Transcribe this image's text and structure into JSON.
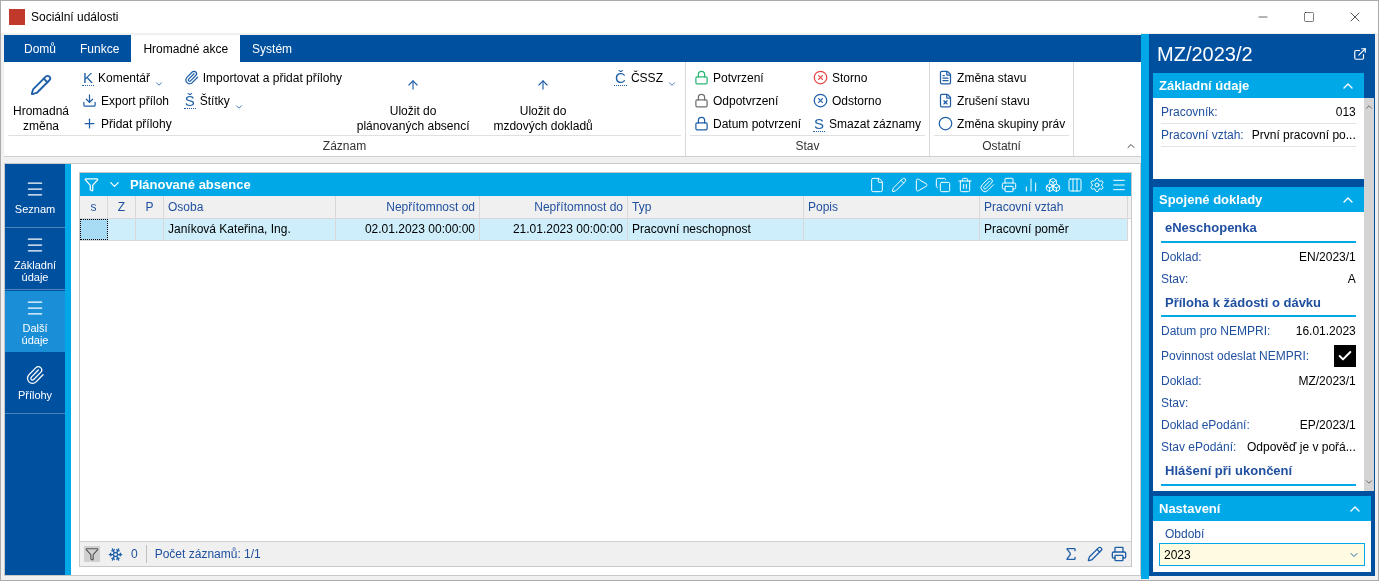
{
  "window": {
    "title": "Sociální události"
  },
  "ribbon": {
    "tabs": [
      {
        "label": "Domů",
        "selected": false
      },
      {
        "label": "Funkce",
        "selected": false
      },
      {
        "label": "Hromadné akce",
        "selected": true
      },
      {
        "label": "Systém",
        "selected": false
      }
    ],
    "groups": [
      {
        "label": "Záznam",
        "columns": [
          {
            "kind": "large",
            "items": [
              {
                "label": "Hromadná změna"
              }
            ]
          },
          {
            "kind": "small",
            "items": [
              {
                "label": "Komentář",
                "glyph": "K",
                "dropdown": true
              },
              {
                "label": "Export příloh"
              },
              {
                "label": "Přidat přílohy"
              }
            ]
          },
          {
            "kind": "small",
            "items": [
              {
                "label": "Importovat a přidat přílohy"
              },
              {
                "label": "Štítky",
                "glyph": "Š",
                "dropdown": true
              }
            ]
          },
          {
            "kind": "large",
            "items": [
              {
                "label": "Uložit do plánovaných absencí"
              }
            ]
          },
          {
            "kind": "large",
            "items": [
              {
                "label": "Uložit do mzdových dokladů"
              }
            ]
          },
          {
            "kind": "small",
            "items": [
              {
                "label": "ČSSZ",
                "glyph": "Č",
                "dropdown": true
              }
            ]
          }
        ]
      },
      {
        "label": "Stav",
        "columns": [
          {
            "kind": "small",
            "items": [
              {
                "label": "Potvrzení"
              },
              {
                "label": "Odpotvrzení"
              },
              {
                "label": "Datum potvrzení"
              }
            ]
          },
          {
            "kind": "small",
            "items": [
              {
                "label": "Storno"
              },
              {
                "label": "Odstorno"
              },
              {
                "label": "Smazat záznamy",
                "glyph": "S"
              }
            ]
          }
        ]
      },
      {
        "label": "Ostatní",
        "columns": [
          {
            "kind": "small",
            "items": [
              {
                "label": "Změna stavu"
              },
              {
                "label": "Zrušení stavu"
              },
              {
                "label": "Změna skupiny práv"
              }
            ]
          }
        ]
      }
    ]
  },
  "nav": [
    {
      "label": "Seznam",
      "selected": false
    },
    {
      "label": "Základní údaje",
      "selected": false
    },
    {
      "label": "Další údaje",
      "selected": true
    },
    {
      "label": "Přílohy",
      "selected": false
    }
  ],
  "grid": {
    "title": "Plánované absence",
    "columns": [
      {
        "label": "s"
      },
      {
        "label": "Z"
      },
      {
        "label": "P"
      },
      {
        "label": "Osoba"
      },
      {
        "label": "Nepřítomnost od"
      },
      {
        "label": "Nepřítomnost do"
      },
      {
        "label": "Typ"
      },
      {
        "label": "Popis"
      },
      {
        "label": "Pracovní vztah"
      }
    ],
    "rows": [
      {
        "selected": true,
        "cells": [
          "",
          "",
          "",
          "Janíková Kateřina, Ing.",
          "02.01.2023 00:00:00",
          "21.01.2023 00:00:00",
          "Pracovní neschopnost",
          "",
          "Pracovní poměr"
        ]
      }
    ],
    "footer": {
      "filter_count": "0",
      "record_count": "Počet záznamů: 1/1"
    }
  },
  "detail": {
    "title": "MZ/2023/2",
    "sections": [
      {
        "title": "Základní údaje",
        "expanded": true,
        "blocks": [
          {
            "fields": [
              {
                "kind": "text",
                "label": "Pracovník:",
                "value": "013"
              },
              {
                "kind": "text",
                "label": "Pracovní vztah:",
                "value": "První pracovní po..."
              }
            ]
          }
        ]
      },
      {
        "title": "Spojené doklady",
        "expanded": true,
        "blocks": [
          {
            "heading": "eNeschopenka",
            "fields": [
              {
                "kind": "text",
                "label": "Doklad:",
                "value": "EN/2023/1"
              },
              {
                "kind": "text",
                "label": "Stav:",
                "value": "A"
              }
            ]
          },
          {
            "heading": "Příloha k žádosti o dávku",
            "fields": [
              {
                "kind": "text",
                "label": "Datum pro NEMPRI:",
                "value": "16.01.2023"
              },
              {
                "kind": "checkbox",
                "label": "Povinnost odeslat NEMPRI:",
                "checked": true
              },
              {
                "kind": "text",
                "label": "Doklad:",
                "value": "MZ/2023/1"
              },
              {
                "kind": "text",
                "label": "Stav:"
              },
              {
                "kind": "text",
                "label": "Doklad ePodání:",
                "value": "EP/2023/1"
              },
              {
                "kind": "text",
                "label": "Stav ePodání:",
                "value": "Odpověď je v pořá..."
              }
            ]
          },
          {
            "heading": "Hlášení při ukončení"
          }
        ]
      }
    ],
    "settings": {
      "title": "Nastavení",
      "expanded": true,
      "field_label": "Období",
      "field_value": "2023"
    }
  }
}
